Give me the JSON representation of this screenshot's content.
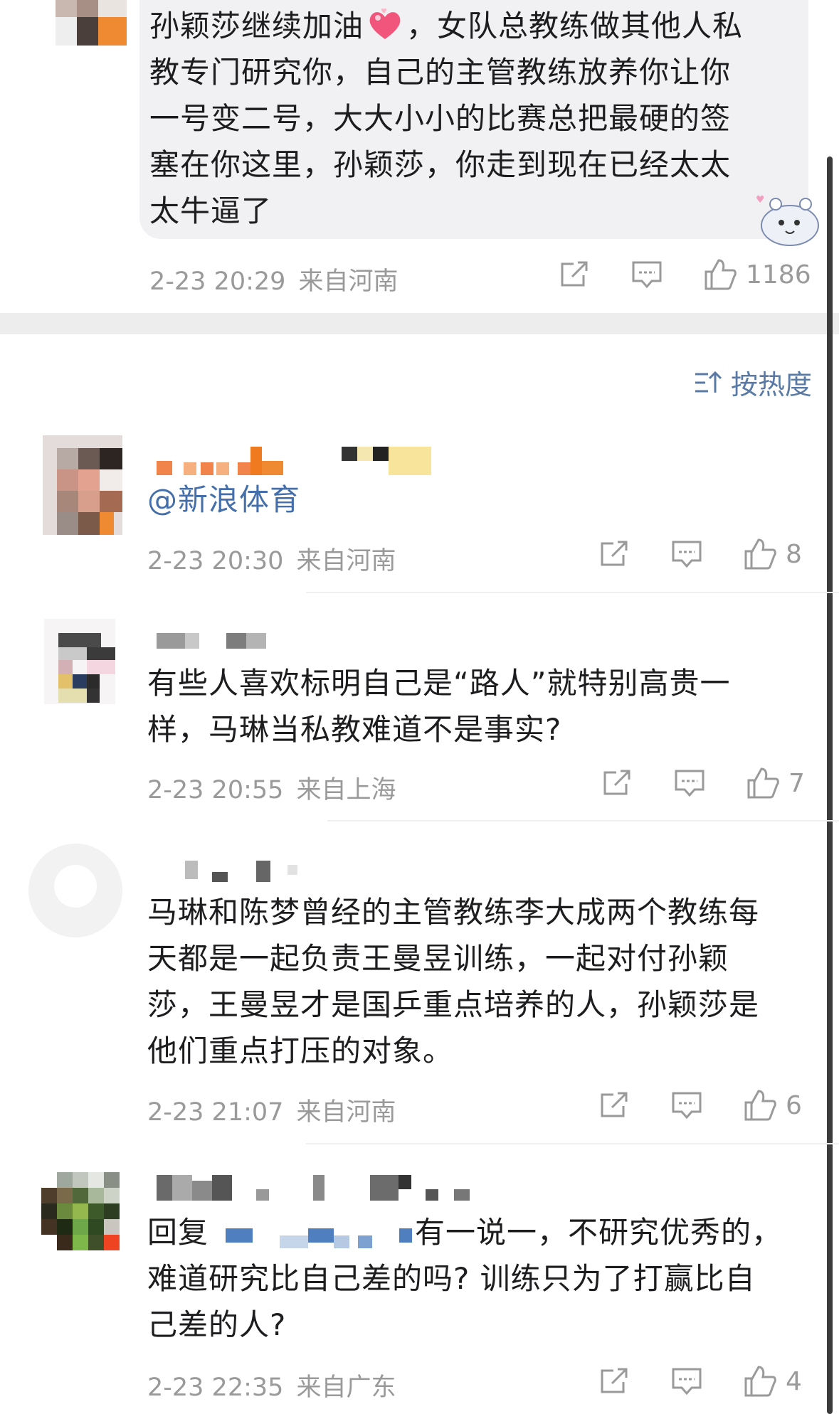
{
  "top_comment": {
    "lines": [
      "孙颖莎继续加油",
      "，女队总教练做其他人私",
      "教专门研究你，自己的主管教练放养你让你",
      "一号变二号，大大小小的比赛总把最硬的签",
      "塞在你这里，孙颖莎，你走到现在已经太太",
      "太牛逼了"
    ],
    "time": "2-23 20:29",
    "location": "来自河南",
    "likes": "1186"
  },
  "sort": {
    "label": "按热度"
  },
  "comments": [
    {
      "text_prefix": "",
      "mention": "@新浪体育",
      "text": "",
      "time": "2-23 20:30",
      "location": "来自河南",
      "likes": "8"
    },
    {
      "text": "有些人喜欢标明自己是“路人”就特别高贵一样，马琳当私教难道不是事实?",
      "line1": "有些人喜欢标明自己是“路人”就特别高贵一",
      "line2": "样，马琳当私教难道不是事实?",
      "time": "2-23 20:55",
      "location": "来自上海",
      "likes": "7"
    },
    {
      "line1": "马琳和陈梦曾经的主管教练李大成两个教练每",
      "line2": "天都是一起负责王曼昱训练，一起对付孙颖",
      "line3": "莎，王曼昱才是国乒重点培养的人，孙颖莎是",
      "line4": "他们重点打压的对象。",
      "time": "2-23 21:07",
      "location": "来自河南",
      "likes": "6"
    },
    {
      "reply_label": "回复",
      "line1": "有一说一，不研究优秀的，",
      "line2": "难道研究比自己差的吗? 训练只为了打赢比自",
      "line3": "己差的人?",
      "time": "2-23 22:35",
      "location": "来自广东",
      "likes": "4"
    }
  ],
  "colors": {
    "accent_link": "#456faa",
    "meta_gray": "#9a9a9a",
    "bubble_bg": "#f1f1f3"
  },
  "icons": [
    "share-icon",
    "comment-icon",
    "like-icon",
    "sort-icon",
    "heart-emoji-icon",
    "sticker-icon"
  ]
}
